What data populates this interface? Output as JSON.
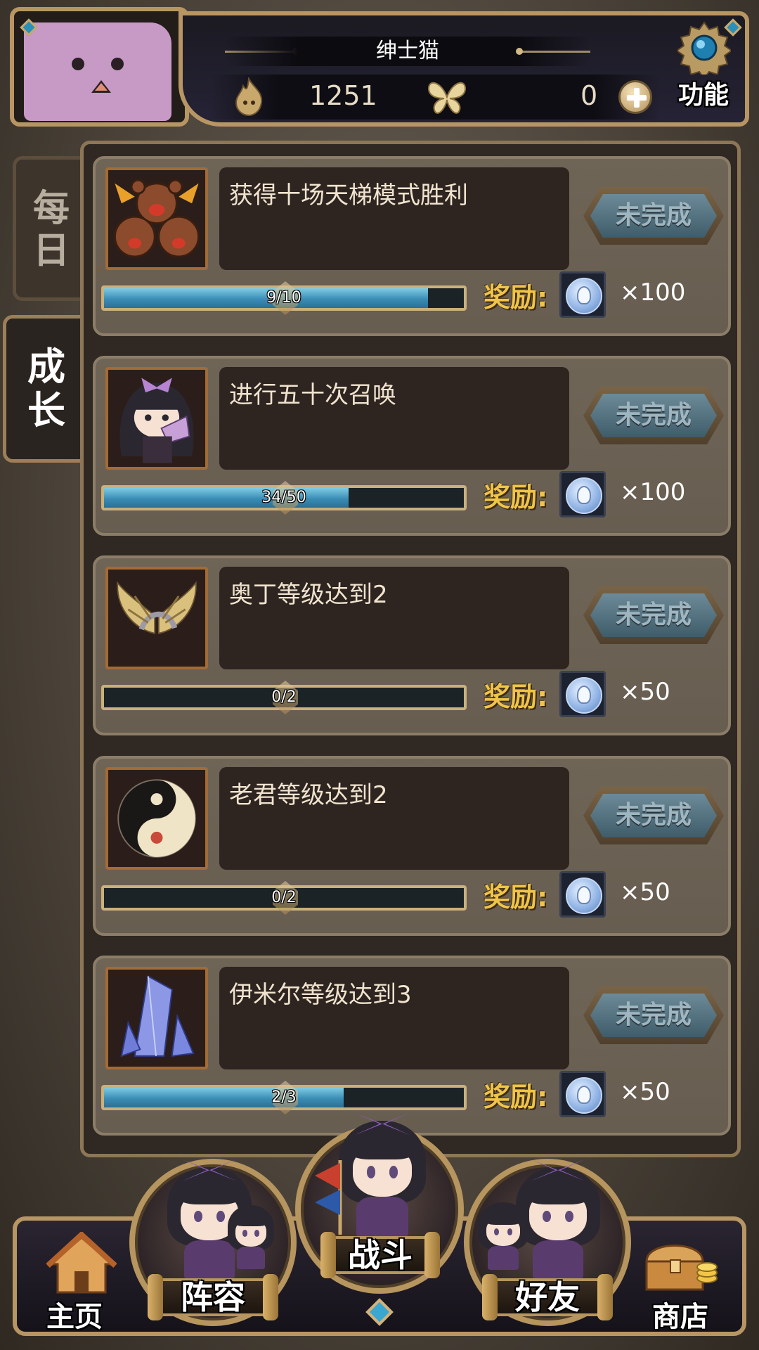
{
  "header": {
    "player_name": "绅士猫",
    "soul_currency_icon": "flame-icon",
    "soul_currency_value": "1251",
    "butterfly_currency_icon": "butterfly-icon",
    "gem_value": "0",
    "function_label": "功能"
  },
  "tabs": [
    {
      "label": "每\n日",
      "active": false
    },
    {
      "label": "成\n长",
      "active": true
    }
  ],
  "reward_label": "奖励:",
  "status_label": "未完成",
  "quests": [
    {
      "icon": "bear-trio-icon",
      "title": "获得十场天梯模式胜利",
      "progress_text": "9/10",
      "progress_value": 0.9,
      "reward_icon": "spirit-coin-icon",
      "reward_amount": "×100"
    },
    {
      "icon": "summoner-girl-icon",
      "title": "进行五十次召唤",
      "progress_text": "34/50",
      "progress_value": 0.68,
      "reward_icon": "spirit-coin-icon",
      "reward_amount": "×100"
    },
    {
      "icon": "winged-helm-icon",
      "title": "奥丁等级达到2",
      "progress_text": "0/2",
      "progress_value": 0.0,
      "reward_icon": "spirit-coin-icon",
      "reward_amount": "×50"
    },
    {
      "icon": "yin-yang-icon",
      "title": "老君等级达到2",
      "progress_text": "0/2",
      "progress_value": 0.0,
      "reward_icon": "spirit-coin-icon",
      "reward_amount": "×50"
    },
    {
      "icon": "ice-crystal-icon",
      "title": "伊米尔等级达到3",
      "progress_text": "2/3",
      "progress_value": 0.6667,
      "reward_icon": "spirit-coin-icon",
      "reward_amount": "×50"
    }
  ],
  "nav": {
    "home": "主页",
    "lineup": "阵容",
    "battle": "战斗",
    "friends": "好友",
    "shop": "商店"
  },
  "colors": {
    "progress_fill": "#3a8db5",
    "reward_gold": "#f0c44a",
    "frame_gold": "#b89664",
    "status_blue": "#4f6e7c"
  }
}
